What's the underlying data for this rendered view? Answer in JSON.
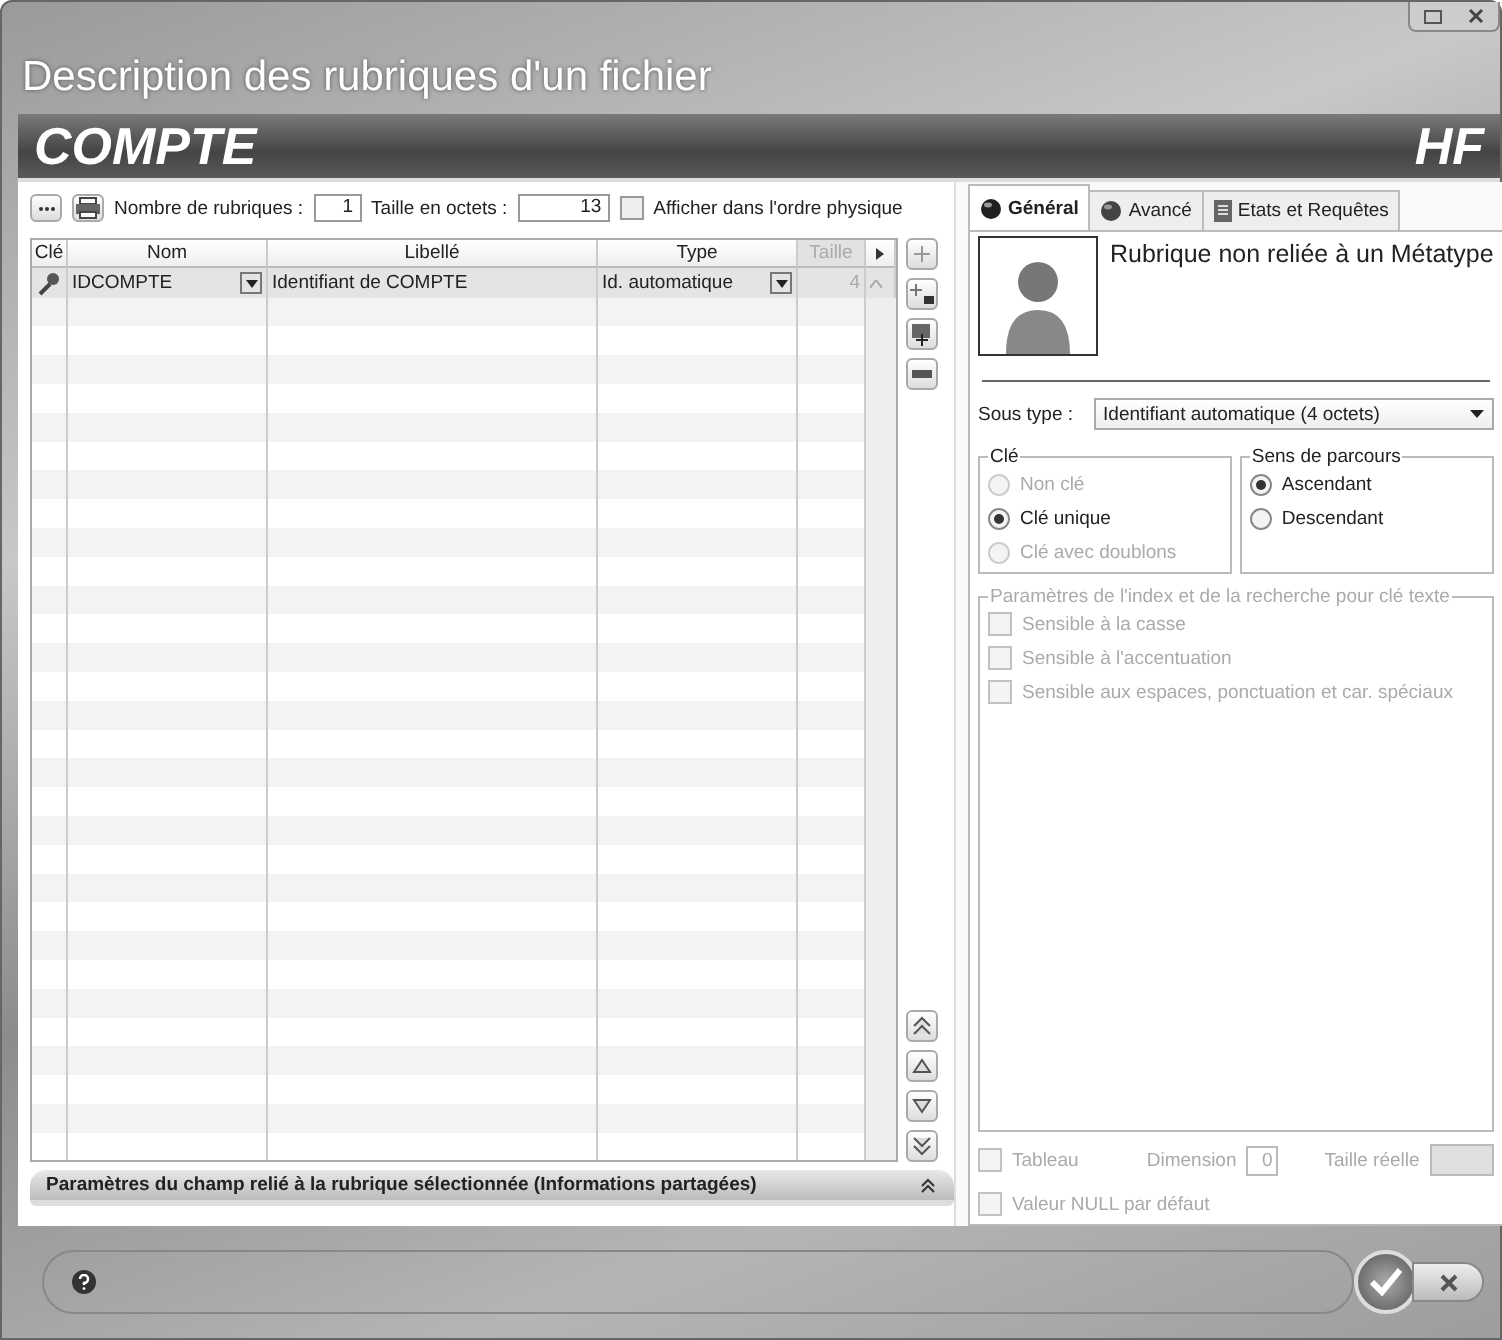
{
  "window": {
    "title": "Description des rubriques d'un fichier",
    "entity": "COMPTE",
    "brand": "HF"
  },
  "toolbar": {
    "count_label": "Nombre de rubriques :",
    "count": "1",
    "size_label": "Taille en octets :",
    "size": "13",
    "physical_order": {
      "label": "Afficher dans l'ordre physique",
      "checked": false
    }
  },
  "table": {
    "columns": [
      {
        "label": "Clé",
        "disabled": false
      },
      {
        "label": "Nom",
        "disabled": false
      },
      {
        "label": "Libellé",
        "disabled": false
      },
      {
        "label": "Type",
        "disabled": false
      },
      {
        "label": "Taille",
        "disabled": true
      }
    ],
    "rows": [
      {
        "key": true,
        "name": "IDCOMPTE",
        "label": "Identifiant de COMPTE",
        "type": "Id. automatique",
        "size": "4",
        "selected": true
      }
    ]
  },
  "shared_panel": {
    "label": "Paramètres du champ relié à la rubrique sélectionnée (Informations partagées)",
    "expanded": false
  },
  "tabs": [
    {
      "label": "Général",
      "selected": true
    },
    {
      "label": "Avancé",
      "selected": false
    },
    {
      "label": "Etats et Requêtes",
      "selected": false
    }
  ],
  "metatype": "Rubrique non reliée à un Métatype",
  "sub_type": {
    "label": "Sous type :",
    "value": "Identifiant automatique (4 octets)"
  },
  "key_group": {
    "title": "Clé",
    "options": [
      {
        "label": "Non clé",
        "selected": false,
        "disabled": true
      },
      {
        "label": "Clé unique",
        "selected": true,
        "disabled": false
      },
      {
        "label": "Clé avec doublons",
        "selected": false,
        "disabled": true
      }
    ]
  },
  "order_group": {
    "title": "Sens de parcours",
    "options": [
      {
        "label": "Ascendant",
        "selected": true,
        "disabled": false
      },
      {
        "label": "Descendant",
        "selected": false,
        "disabled": false
      }
    ]
  },
  "index_group": {
    "title": "Paramètres de l'index et de la recherche pour clé texte",
    "disabled": true,
    "options": [
      {
        "label": "Sensible à la casse",
        "checked": false
      },
      {
        "label": "Sensible à l'accentuation",
        "checked": false
      },
      {
        "label": "Sensible aux espaces, ponctuation et car. spéciaux",
        "checked": false
      }
    ]
  },
  "array": {
    "label": "Tableau",
    "checked": false,
    "disabled": true,
    "dimension_label": "Dimension",
    "dimension": "0",
    "real_size_label": "Taille réelle"
  },
  "null_default": {
    "label": "Valeur NULL par défaut",
    "checked": false,
    "disabled": true
  }
}
